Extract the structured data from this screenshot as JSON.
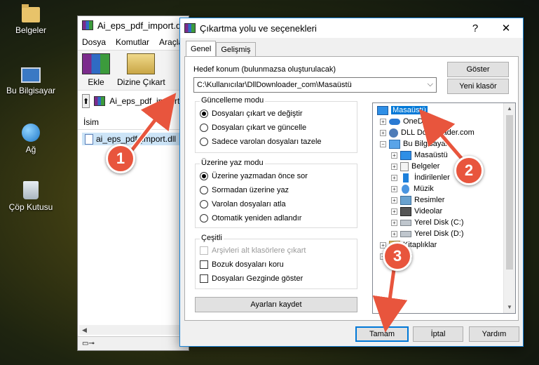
{
  "desktop": {
    "icons": [
      {
        "label": "Belgeler"
      },
      {
        "label": "Bu Bilgisayar"
      },
      {
        "label": "Ağ"
      },
      {
        "label": "Çöp Kutusu"
      }
    ]
  },
  "winrar": {
    "title": "Ai_eps_pdf_import.dll",
    "menu": [
      "Dosya",
      "Komutlar",
      "Araçlar"
    ],
    "toolbar": {
      "add_label": "Ekle",
      "extract_label": "Dizine Çıkart"
    },
    "path": "Ai_eps_pdf_import.dll",
    "column_header": "İsim",
    "file_name": "ai_eps_pdf_import.dll"
  },
  "dialog": {
    "title": "Çıkartma yolu ve seçenekleri",
    "help_glyph": "?",
    "close_glyph": "✕",
    "tabs": [
      "Genel",
      "Gelişmiş"
    ],
    "dest_label": "Hedef konum (bulunmazsa oluşturulacak)",
    "dest_value": "C:\\Kullanıcılar\\DllDownloader_com\\Masaüstü",
    "show_button": "Göster",
    "new_folder_button": "Yeni klasör",
    "update_group": {
      "title": "Güncelleme modu",
      "options": [
        "Dosyaları çıkart ve değiştir",
        "Dosyaları çıkart ve güncelle",
        "Sadece varolan dosyaları tazele"
      ],
      "selected": 0
    },
    "overwrite_group": {
      "title": "Üzerine yaz modu",
      "options": [
        "Üzerine yazmadan önce sor",
        "Sormadan üzerine yaz",
        "Varolan dosyaları atla",
        "Otomatik yeniden adlandır"
      ],
      "selected": 0
    },
    "misc_group": {
      "title": "Çeşitli",
      "options": [
        "Arşivleri alt klasörlere çıkart",
        "Bozuk dosyaları koru",
        "Dosyaları Gezginde göster"
      ]
    },
    "save_settings_button": "Ayarları kaydet",
    "tree": {
      "items": [
        "Masaüstü",
        "OneDrive",
        "DLL Downloader.com",
        "Bu Bilgisayar",
        "Masaüstü",
        "Belgeler",
        "İndirilenler",
        "Müzik",
        "Resimler",
        "Videolar",
        "Yerel Disk (C:)",
        "Yerel Disk (D:)",
        "Kitaplıklar",
        "Ağ"
      ]
    },
    "ok_button": "Tamam",
    "cancel_button": "İptal",
    "help_button": "Yardım"
  },
  "annotations": {
    "steps": [
      "1",
      "2",
      "3"
    ],
    "accent_color": "#e8553d"
  }
}
